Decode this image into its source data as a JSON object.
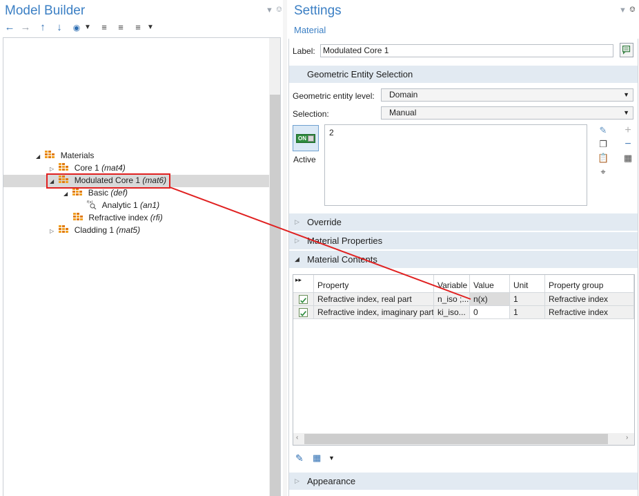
{
  "model_builder": {
    "title": "Model Builder",
    "toolbar": [
      "back-arrow-icon",
      "forward-arrow-icon",
      "move-up-icon",
      "move-down-icon",
      "show-icon",
      "expand-sections-icon",
      "collapse-sections-icon",
      "tree-options-icon"
    ],
    "tree": {
      "materials": {
        "label": "Materials"
      },
      "core1": {
        "label": "Core 1",
        "tag": "(mat4)"
      },
      "modulated_core": {
        "label": "Modulated Core 1",
        "tag": "(mat6)"
      },
      "basic": {
        "label": "Basic",
        "tag": "(def)"
      },
      "analytic": {
        "label": "Analytic 1",
        "tag": "(an1)"
      },
      "refractive": {
        "label": "Refractive index",
        "tag": "(rfi)"
      },
      "cladding": {
        "label": "Cladding 1",
        "tag": "(mat5)"
      }
    }
  },
  "settings": {
    "title": "Settings",
    "subtitle": "Material",
    "label_field": {
      "label": "Label:",
      "value": "Modulated Core 1"
    },
    "geometric_section": {
      "title": "Geometric Entity Selection"
    },
    "entity_level": {
      "label": "Geometric entity level:",
      "value": "Domain"
    },
    "selection": {
      "label": "Selection:",
      "value": "Manual"
    },
    "active": {
      "toggle_text": "ON",
      "label": "Active"
    },
    "selection_list": [
      "2"
    ],
    "override_section": {
      "title": "Override"
    },
    "material_properties_section": {
      "title": "Material Properties"
    },
    "material_contents_section": {
      "title": "Material Contents"
    },
    "appearance_section": {
      "title": "Appearance"
    },
    "table": {
      "columns": [
        "Property",
        "Variable",
        "Value",
        "Unit",
        "Property group"
      ],
      "rows": [
        {
          "property": "Refractive index, real part",
          "variable": "n_iso ;...",
          "value": "n(x)",
          "unit": "1",
          "group": "Refractive index"
        },
        {
          "property": "Refractive index, imaginary part",
          "variable": "ki_iso...",
          "value": "0",
          "unit": "1",
          "group": "Refractive index"
        }
      ]
    }
  },
  "colors": {
    "accent": "#3b7fc4",
    "section_bar": "#e2eaf2",
    "highlight_box": "#e02020",
    "annotation_line": "#e02020"
  }
}
